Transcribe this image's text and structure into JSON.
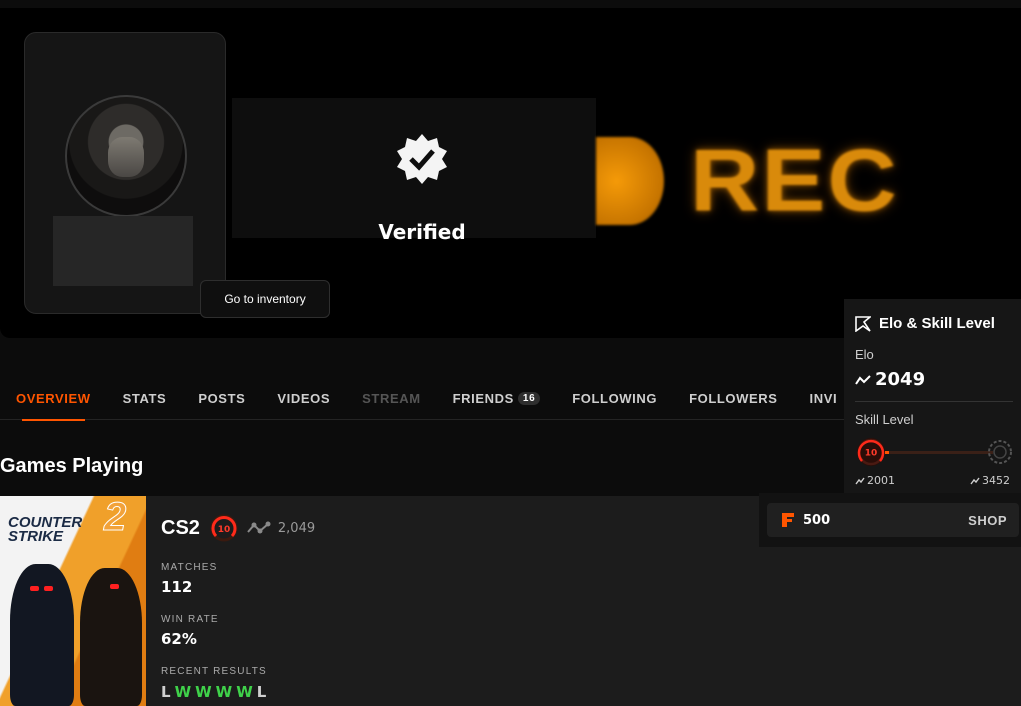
{
  "banner": {
    "verified_label": "Verified",
    "overlay_text": "REC",
    "inventory_button": "Go to inventory"
  },
  "tabs": [
    {
      "label": "OVERVIEW",
      "active": true
    },
    {
      "label": "STATS"
    },
    {
      "label": "POSTS"
    },
    {
      "label": "VIDEOS"
    },
    {
      "label": "STREAM",
      "disabled": true
    },
    {
      "label": "FRIENDS",
      "count": "16"
    },
    {
      "label": "FOLLOWING"
    },
    {
      "label": "FOLLOWERS"
    },
    {
      "label": "INVI"
    }
  ],
  "games": {
    "section_title": "Games Playing",
    "game": {
      "logo_text": "COUNTER STRIKE",
      "logo_number": "2",
      "name": "CS2",
      "level": "10",
      "elo": "2,049",
      "matches_label": "MATCHES",
      "matches_value": "112",
      "winrate_label": "WIN RATE",
      "winrate_value": "62%",
      "recent_label": "RECENT RESULTS",
      "recent_results": [
        "L",
        "W",
        "W",
        "W",
        "W",
        "L"
      ]
    }
  },
  "elo_panel": {
    "title": "Elo & Skill Level",
    "elo_label": "Elo",
    "elo_value": "2049",
    "skill_label": "Skill Level",
    "current_level": "10",
    "range_min": "2001",
    "range_max": "3452"
  },
  "shop": {
    "points": "500",
    "link_label": "SHOP"
  },
  "colors": {
    "accent": "#ff5500",
    "win": "#3fd24a",
    "background": "#0c0c0c"
  }
}
